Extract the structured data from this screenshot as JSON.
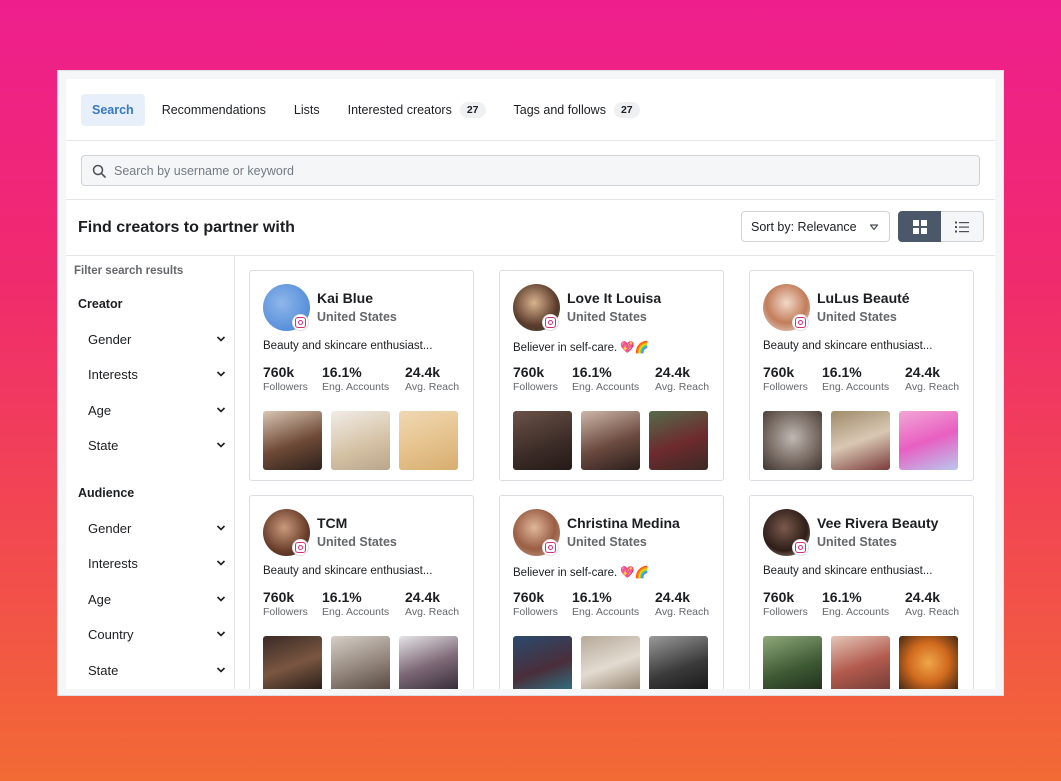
{
  "tabs": [
    {
      "label": "Search",
      "active": true
    },
    {
      "label": "Recommendations"
    },
    {
      "label": "Lists"
    },
    {
      "label": "Interested creators",
      "count": "27"
    },
    {
      "label": "Tags and follows",
      "count": "27"
    }
  ],
  "search": {
    "placeholder": "Search by username or keyword",
    "value": ""
  },
  "page": {
    "title": "Find creators to partner with"
  },
  "sort": {
    "label": "Sort by: Relevance"
  },
  "view": {
    "active": "grid"
  },
  "filters": {
    "title": "Filter search results",
    "creator": {
      "heading": "Creator",
      "items": [
        "Gender",
        "Interests",
        "Age",
        "State"
      ]
    },
    "audience": {
      "heading": "Audience",
      "items": [
        "Gender",
        "Interests",
        "Age",
        "Country",
        "State"
      ]
    }
  },
  "stat_labels": {
    "followers": "Followers",
    "engagement": "Eng. Accounts",
    "reach": "Avg. Reach"
  },
  "creators": [
    {
      "name": "Kai Blue",
      "country": "United States",
      "bio": "Beauty and skincare enthusiast...",
      "followers": "760k",
      "engagement": "16.1%",
      "reach": "24.4k"
    },
    {
      "name": "Love It Louisa",
      "country": "United States",
      "bio": "Believer in self-care. 💖🌈",
      "followers": "760k",
      "engagement": "16.1%",
      "reach": "24.4k"
    },
    {
      "name": "LuLus Beauté",
      "country": "United States",
      "bio": "Beauty and skincare enthusiast...",
      "followers": "760k",
      "engagement": "16.1%",
      "reach": "24.4k"
    },
    {
      "name": "TCM",
      "country": "United States",
      "bio": "Beauty and skincare enthusiast...",
      "followers": "760k",
      "engagement": "16.1%",
      "reach": "24.4k"
    },
    {
      "name": "Christina Medina",
      "country": "United States",
      "bio": "Believer in self-care. 💖🌈",
      "followers": "760k",
      "engagement": "16.1%",
      "reach": "24.4k"
    },
    {
      "name": "Vee Rivera Beauty",
      "country": "United States",
      "bio": "Beauty and skincare enthusiast...",
      "followers": "760k",
      "engagement": "16.1%",
      "reach": "24.4k"
    }
  ],
  "colors": {
    "accent": "#3578c5",
    "brand_gradient_top": "#ee1f8d",
    "brand_gradient_bottom": "#f26a34",
    "view_toggle_active": "#4b5869"
  }
}
